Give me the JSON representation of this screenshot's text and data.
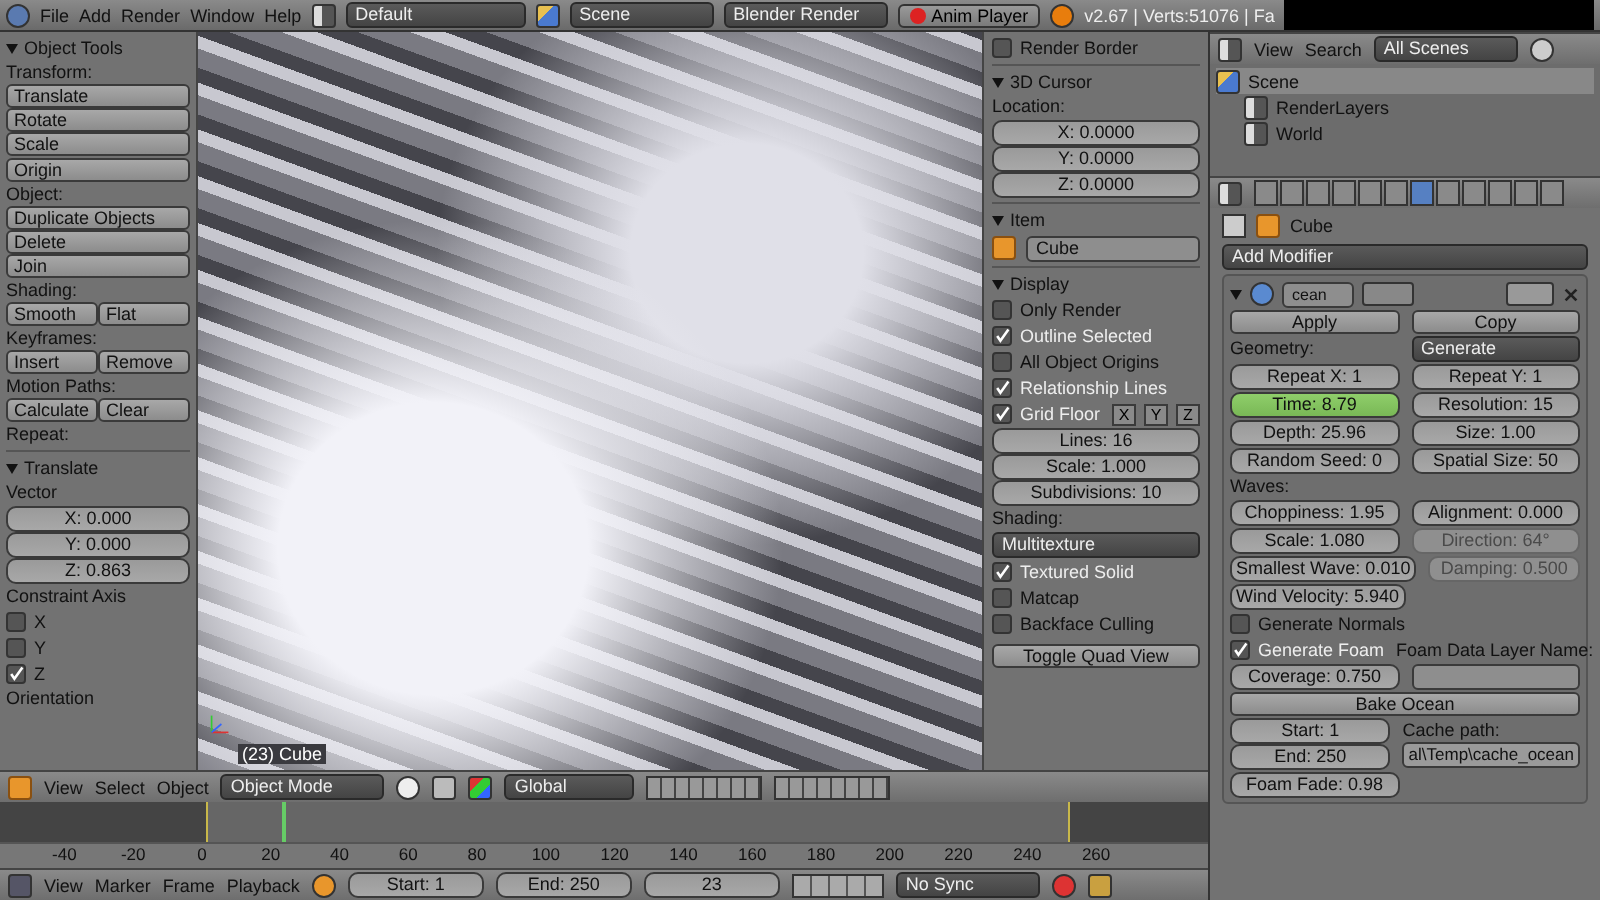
{
  "top_bar": {
    "menus": [
      "File",
      "Add",
      "Render",
      "Window",
      "Help"
    ],
    "layout": "Default",
    "scene": "Scene",
    "engine": "Blender Render",
    "anim_player": "Anim Player",
    "stats": "v2.67 | Verts:51076 | Fa"
  },
  "tool_shelf": {
    "title": "Object Tools",
    "groups": [
      {
        "label": "Transform:",
        "rows": [
          [
            "Translate"
          ],
          [
            "Rotate"
          ],
          [
            "Scale"
          ]
        ]
      },
      {
        "rows": [
          [
            "Origin"
          ]
        ]
      },
      {
        "label": "Object:",
        "rows": [
          [
            "Duplicate Objects"
          ],
          [
            "Delete"
          ],
          [
            "Join"
          ]
        ]
      },
      {
        "label": "Shading:",
        "rows": [
          [
            "Smooth",
            "Flat"
          ]
        ]
      },
      {
        "label": "Keyframes:",
        "rows": [
          [
            "Insert",
            "Remove"
          ]
        ]
      },
      {
        "label": "Motion Paths:",
        "rows": [
          [
            "Calculate",
            "Clear"
          ]
        ]
      },
      {
        "label": "Repeat:"
      }
    ]
  },
  "operator": {
    "title": "Translate",
    "vector_label": "Vector",
    "vector": [
      "X: 0.000",
      "Y: 0.000",
      "Z: 0.863"
    ],
    "constraint_label": "Constraint Axis",
    "axes": [
      {
        "label": "X",
        "checked": false
      },
      {
        "label": "Y",
        "checked": false
      },
      {
        "label": "Z",
        "checked": true
      }
    ],
    "orientation_label": "Orientation"
  },
  "viewport": {
    "header_menus": [
      "View",
      "Select",
      "Object"
    ],
    "mode": "Object Mode",
    "orientation": "Global",
    "object_label": "(23) Cube"
  },
  "n_panel": {
    "render_border": {
      "label": "Render Border",
      "checked": false
    },
    "cursor": {
      "title": "3D Cursor",
      "label": "Location:",
      "values": [
        "X: 0.0000",
        "Y: 0.0000",
        "Z: 0.0000"
      ]
    },
    "item": {
      "title": "Item",
      "name": "Cube"
    },
    "display": {
      "title": "Display",
      "checks": [
        {
          "label": "Only Render",
          "checked": false
        },
        {
          "label": "Outline Selected",
          "checked": true
        },
        {
          "label": "All Object Origins",
          "checked": false
        },
        {
          "label": "Relationship Lines",
          "checked": true
        }
      ],
      "grid_floor": {
        "label": "Grid Floor",
        "checked": true,
        "axes": [
          "X",
          "Y",
          "Z"
        ]
      },
      "grid_values": [
        "Lines: 16",
        "Scale: 1.000",
        "Subdivisions: 10"
      ],
      "shading_label": "Shading:",
      "shading": "Multitexture",
      "shading_checks": [
        {
          "label": "Textured Solid",
          "checked": true
        },
        {
          "label": "Matcap",
          "checked": false
        },
        {
          "label": "Backface Culling",
          "checked": false
        }
      ],
      "button": "Toggle Quad View"
    }
  },
  "outliner": {
    "menus": [
      "View",
      "Search"
    ],
    "filter": "All Scenes",
    "tree": [
      {
        "label": "Scene",
        "children": [
          {
            "label": "RenderLayers"
          },
          {
            "label": "World"
          }
        ]
      }
    ]
  },
  "properties": {
    "context_tabs": [
      {
        "selected": false
      },
      {
        "selected": false
      },
      {
        "selected": false
      },
      {
        "selected": false
      },
      {
        "selected": false
      },
      {
        "selected": false
      },
      {
        "selected": true
      },
      {
        "selected": false
      },
      {
        "selected": false
      },
      {
        "selected": false
      },
      {
        "selected": false
      },
      {
        "selected": false
      }
    ],
    "breadcrumb": "Cube",
    "add_modifier": "Add Modifier",
    "modifier": {
      "name": "cean",
      "apply": "Apply",
      "copy": "Copy",
      "geometry_label": "Geometry:",
      "geometry": "Generate",
      "rows": [
        [
          {
            "text": "Repeat X: 1",
            "kind": "normal"
          },
          {
            "text": "Repeat Y: 1",
            "kind": "normal"
          }
        ],
        [
          {
            "text": "Time: 8.79",
            "kind": "animated"
          },
          {
            "text": "Resolution: 15",
            "kind": "normal"
          }
        ],
        [
          {
            "text": "Depth: 25.96",
            "kind": "normal"
          },
          {
            "text": "Size: 1.00",
            "kind": "normal"
          }
        ],
        [
          {
            "text": "Random Seed: 0",
            "kind": "normal"
          },
          {
            "text": "Spatial Size: 50",
            "kind": "normal"
          }
        ]
      ],
      "waves_label": "Waves:",
      "wave_rows": [
        [
          {
            "text": "Choppiness: 1.95",
            "kind": "normal"
          },
          {
            "text": "Alignment: 0.000",
            "kind": "normal"
          }
        ],
        [
          {
            "text": "Scale: 1.080",
            "kind": "normal"
          },
          {
            "text": "Direction: 64°",
            "kind": "disabled"
          }
        ],
        [
          {
            "text": "Smallest Wave: 0.010",
            "kind": "normal"
          },
          {
            "text": "Damping: 0.500",
            "kind": "disabled"
          }
        ],
        [
          {
            "text": "Wind Velocity: 5.940",
            "kind": "normal"
          }
        ]
      ],
      "generate_normals": {
        "label": "Generate Normals",
        "checked": false
      },
      "generate_foam": {
        "label": "Generate Foam",
        "checked": true
      },
      "foam_layer_label": "Foam Data Layer Name:",
      "coverage": "Coverage: 0.750",
      "bake": "Bake Ocean",
      "start": "Start: 1",
      "end": "End: 250",
      "foam_fade": "Foam Fade: 0.98",
      "cache_label": "Cache path:",
      "cache_path": "al\\Temp\\cache_ocean"
    }
  },
  "timeline": {
    "ticks": [
      "-40",
      "-20",
      "0",
      "20",
      "40",
      "60",
      "80",
      "100",
      "120",
      "140",
      "160",
      "180",
      "200",
      "220",
      "240",
      "260"
    ],
    "menus": [
      "View",
      "Marker",
      "Frame",
      "Playback"
    ],
    "start": "Start: 1",
    "end": "End: 250",
    "frame": "23",
    "sync": "No Sync"
  }
}
